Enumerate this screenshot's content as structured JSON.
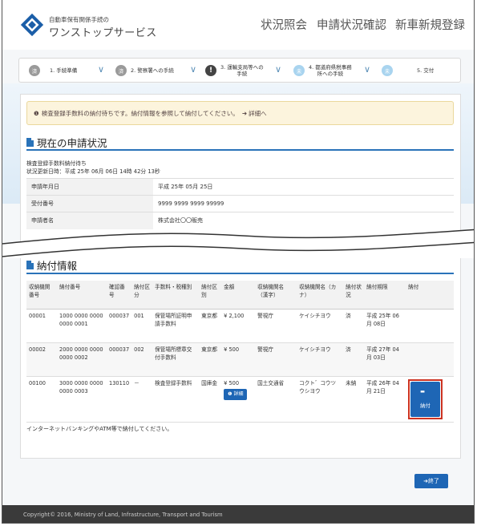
{
  "header": {
    "brand_small": "自動車保有関係手続の",
    "brand_large": "ワンストップサービス",
    "nav": [
      "状況照会",
      "申請状況確認",
      "新車新規登録"
    ]
  },
  "steps": [
    {
      "badge": "済",
      "label": "1. 手続準備",
      "state": "done"
    },
    {
      "badge": "済",
      "label": "2. 警察署への手続",
      "state": "done"
    },
    {
      "badge": "!",
      "label": "3. 運輸支局等への\n手続",
      "state": "current"
    },
    {
      "badge": "未",
      "label": "4. 都道府県税事務\n所への手続",
      "state": "todo"
    },
    {
      "badge": "未",
      "label": "5. 交付",
      "state": "todo"
    }
  ],
  "alert": {
    "text": "検査登録手数料の納付待ちです。納付情報を参照して納付してください。",
    "link": "詳細へ"
  },
  "status_section": {
    "title": "現在の申請状況",
    "status_text": "検査登録手数料納付待ち",
    "updated": "状況更新日時：平成 25年 06月 06日 14時 42分 13秒",
    "rows": [
      {
        "label": "申請年月日",
        "value": "平成 25年 05月 25日"
      },
      {
        "label": "受付番号",
        "value": "9999 9999 9999 99999"
      },
      {
        "label": "申請者名",
        "value": "株式会社〇〇販売"
      }
    ]
  },
  "payment_section": {
    "title": "納付情報",
    "columns": [
      "収納機関番号",
      "納付番号",
      "確認番号",
      "納付区分",
      "手数料・税種別",
      "納付区別",
      "金額",
      "収納機関名（漢字）",
      "収納機関名（カナ）",
      "納付状況",
      "納付期限",
      "納付"
    ],
    "rows": [
      {
        "c1": "00001",
        "c2": "1000 0000 0000 0000 0001",
        "c3": "000037",
        "c4": "001",
        "c5": "保管場所証明申請手数料",
        "c6": "東京都",
        "amount": "¥ 2,100",
        "c8": "警視庁",
        "c9": "ケイシチヨウ",
        "c10": "済",
        "c11": "平成 25年 06月 08日",
        "detail": "",
        "pay": ""
      },
      {
        "c1": "00002",
        "c2": "2000 0000 0000 0000 0002",
        "c3": "000037",
        "c4": "002",
        "c5": "保管場所標章交付手数料",
        "c6": "東京都",
        "amount": "¥ 500",
        "c8": "警視庁",
        "c9": "ケイシチヨウ",
        "c10": "済",
        "c11": "平成 27年 04月 03日",
        "detail": "",
        "pay": ""
      },
      {
        "c1": "00100",
        "c2": "3000 0000 0000 0000 0003",
        "c3": "130110",
        "c4": "－",
        "c5": "検査登録手数料",
        "c6": "国庫金",
        "amount": "¥ 500",
        "c8": "国土交通省",
        "c9": "コクト゛コウツウシヨウ",
        "c10": "未納",
        "c11": "平成 26年 04月 21日",
        "detail": "詳細",
        "pay": "納付"
      }
    ],
    "note": "インターネットバンキングやATM等で納付してください。"
  },
  "end_button": "終了",
  "footer": "Copyright© 2016, Ministry of Land, Infrastructure, Transport and Tourism",
  "colors": {
    "accent": "#2a73b9",
    "button": "#1e66b5",
    "alert_bg": "#fcf4dd",
    "highlight": "#cc3322"
  }
}
